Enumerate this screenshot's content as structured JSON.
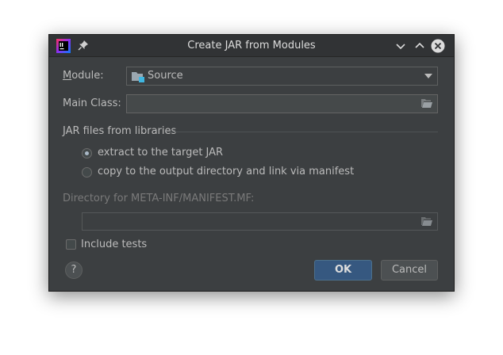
{
  "window": {
    "title": "Create JAR from Modules"
  },
  "module": {
    "label": "Module:",
    "value": "Source"
  },
  "main_class": {
    "label": "Main Class:",
    "value": ""
  },
  "jar_libraries": {
    "heading": "JAR files from libraries",
    "options": [
      {
        "label": "extract to the target JAR",
        "selected": true
      },
      {
        "label": "copy to the output directory and link via manifest",
        "selected": false
      }
    ]
  },
  "manifest_dir": {
    "label": "Directory for META-INF/MANIFEST.MF:",
    "value": ""
  },
  "include_tests": {
    "label": "Include tests",
    "checked": false
  },
  "buttons": {
    "help": "?",
    "ok": "OK",
    "cancel": "Cancel"
  },
  "colors": {
    "dialog_bg": "#3c3f41",
    "primary_button": "#365880"
  }
}
